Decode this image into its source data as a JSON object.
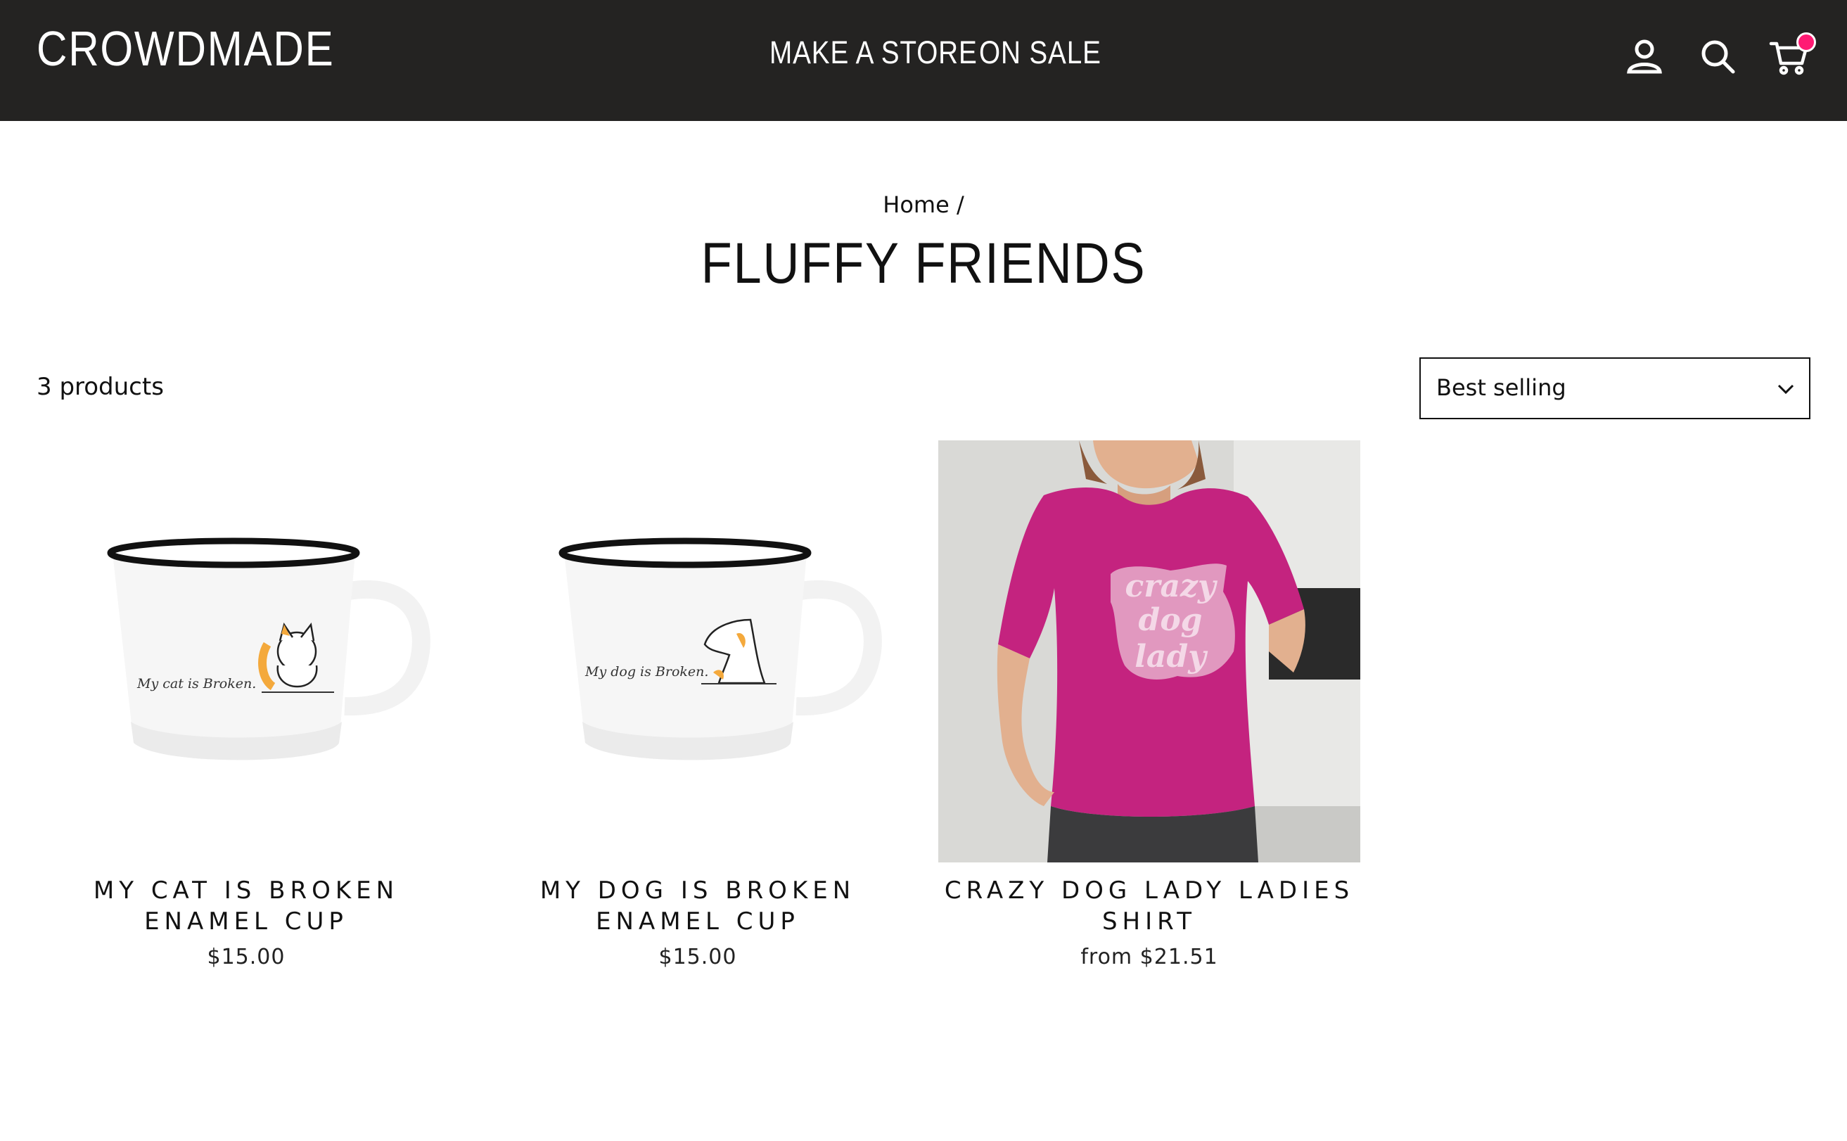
{
  "header": {
    "logo": "CROWDMADE",
    "nav": [
      "MAKE A STORE",
      "ON SALE"
    ],
    "icons": [
      "account-icon",
      "search-icon",
      "cart-icon"
    ],
    "cart_badge_color": "#ff1a73",
    "background": "#242322"
  },
  "breadcrumb": "Home /",
  "page_title": "FLUFFY FRIENDS",
  "product_count": "3 products",
  "sort": {
    "selected": "Best selling"
  },
  "products": [
    {
      "name": "MY CAT IS BROKEN ENAMEL CUP",
      "price": "$15.00",
      "mug_text": "My cat is Broken."
    },
    {
      "name": "MY DOG IS BROKEN ENAMEL CUP",
      "price": "$15.00",
      "mug_text": "My dog is Broken."
    },
    {
      "name": "CRAZY DOG LADY LADIES SHIRT",
      "price": "from $21.51",
      "shirt_text": [
        "crazy",
        "dog",
        "lady"
      ],
      "shirt_color": "#c4237f"
    }
  ]
}
